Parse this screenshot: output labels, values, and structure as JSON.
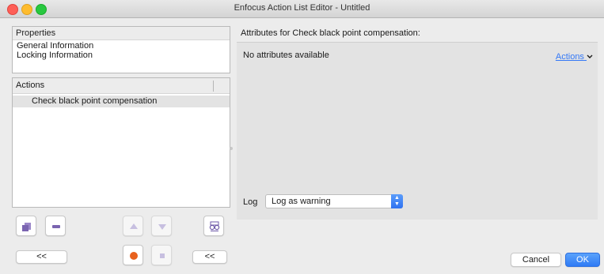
{
  "window": {
    "title": "Enfocus Action List Editor - Untitled"
  },
  "properties": {
    "header": "Properties",
    "items": [
      "General Information",
      "Locking Information"
    ]
  },
  "actions_list": {
    "header": "Actions",
    "items": [
      "Check black point compensation"
    ]
  },
  "toolbar": {
    "back_label_left": "<<",
    "back_label_right": "<<"
  },
  "attributes": {
    "title": "Attributes for Check black point compensation:",
    "empty_text": "No attributes available",
    "actions_menu": "Actions"
  },
  "log": {
    "label": "Log",
    "value": "Log as warning"
  },
  "dialog": {
    "cancel": "Cancel",
    "ok": "OK"
  }
}
